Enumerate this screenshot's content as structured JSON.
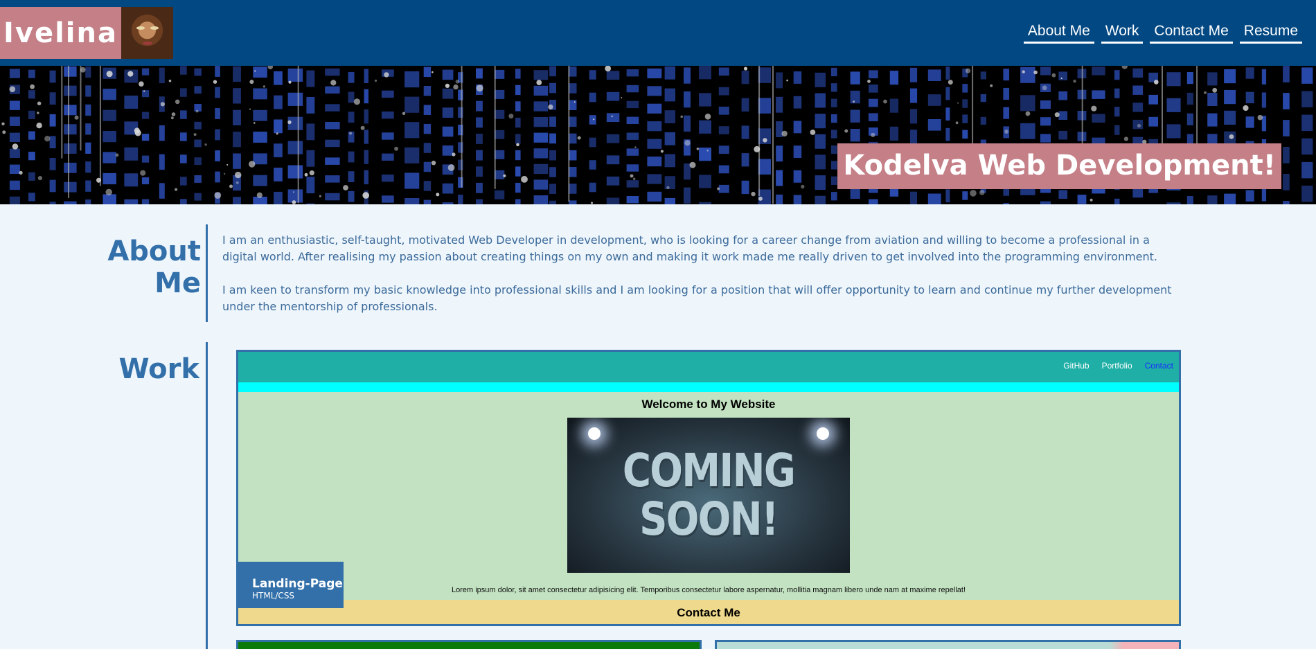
{
  "header": {
    "brand": "Ivelina",
    "nav": [
      "About Me",
      "Work",
      "Contact Me",
      "Resume"
    ]
  },
  "hero": {
    "title": "Kodelva Web Development!"
  },
  "about": {
    "title": "About Me",
    "paragraphs": [
      "I am an enthusiastic, self-taught, motivated Web Developer in development, who is looking for a career change from aviation and willing to become a professional in a digital world. After realising my passion about creating things on my own and making it work made me really driven to get involved into the programming environment.",
      "I am keen to transform my basic knowledge into professional skills and I am looking for a position that will offer opportunity to learn and continue my further development under the mentorship of professionals."
    ]
  },
  "work": {
    "title": "Work",
    "project": {
      "nav_links": [
        "GitHub",
        "Portfolio",
        "Contact"
      ],
      "heading": "Welcome to My Website",
      "image_text": "COMING SOON!",
      "lorem": "Lorem ipsum dolor, sit amet consectetur adipisicing elit. Temporibus consectetur labore aspernatur, mollitia magnam libero unde nam at maxime repellat!",
      "footer": "Contact Me",
      "badge_title": "Landing-Page",
      "badge_sub": "HTML/CSS"
    }
  },
  "colors": {
    "header_bg": "#024883",
    "accent_pink": "#c47f87",
    "accent_blue": "#3370aa",
    "page_bg": "#eef6fc"
  }
}
